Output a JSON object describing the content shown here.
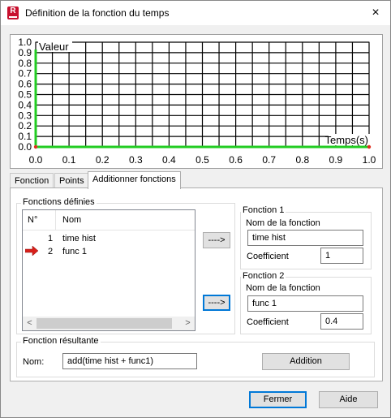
{
  "window": {
    "title": "Définition de la fonction du temps",
    "close_icon": "×",
    "app_icon_letter": "R"
  },
  "chart_data": {
    "type": "line",
    "xlabel": "Temps(s)",
    "ylabel": "Valeur",
    "xlim": [
      0.0,
      1.0
    ],
    "ylim": [
      0.0,
      1.0
    ],
    "grid": true,
    "x_ticks": [
      "0.0",
      "0.1",
      "0.2",
      "0.3",
      "0.4",
      "0.5",
      "0.6",
      "0.7",
      "0.8",
      "0.9",
      "1.0"
    ],
    "y_ticks": [
      "0.0",
      "0.1",
      "0.2",
      "0.3",
      "0.4",
      "0.5",
      "0.6",
      "0.7",
      "0.8",
      "0.9",
      "1.0"
    ],
    "series": [
      {
        "color": "#22cc22",
        "x": [
          0.0,
          0.0,
          1.0
        ],
        "y": [
          0.93,
          0.0,
          0.0
        ]
      }
    ],
    "markers": [
      {
        "x": 0.0,
        "y": 0.0,
        "color": "#e03020"
      },
      {
        "x": 1.0,
        "y": 0.0,
        "color": "#e03020"
      }
    ]
  },
  "tabs": [
    {
      "label": "Fonction"
    },
    {
      "label": "Points"
    },
    {
      "label": "Additionner fonctions",
      "active": true
    }
  ],
  "defined_functions": {
    "group_label": "Fonctions définies",
    "col_number": "N°",
    "col_name": "Nom",
    "rows": [
      {
        "number": "1",
        "name": "time hist",
        "selected": false
      },
      {
        "number": "2",
        "name": "func 1",
        "selected": true
      }
    ],
    "scroll_left_icon": "<",
    "scroll_right_icon": ">"
  },
  "assign_button_1": "---->",
  "assign_button_2": "---->",
  "function1": {
    "group_label": "Fonction 1",
    "name_label": "Nom de la fonction",
    "name_value": "time hist",
    "coef_label": "Coefficient",
    "coef_value": "1"
  },
  "function2": {
    "group_label": "Fonction 2",
    "name_label": "Nom de la fonction",
    "name_value": "func 1",
    "coef_label": "Coefficient",
    "coef_value": "0.4"
  },
  "result": {
    "group_label": "Fonction résultante",
    "name_label": "Nom:",
    "name_value": "add(time hist + func1)",
    "addition_button": "Addition"
  },
  "footer": {
    "close_button": "Fermer",
    "help_button": "Aide"
  }
}
